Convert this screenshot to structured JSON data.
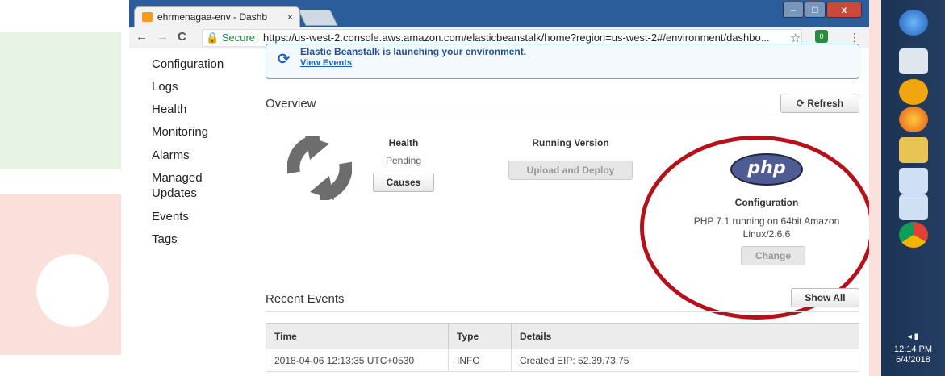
{
  "browser": {
    "tab_title": "ehrmenagaa-env - Dashb",
    "tab_close": "×",
    "secure_label": "Secure",
    "url": "https://us-west-2.console.aws.amazon.com/elasticbeanstalk/home?region=us-west-2#/environment/dashbo...",
    "back": "←",
    "forward": "→",
    "reload": "C",
    "star": "☆",
    "menu": "⋮",
    "window_min": "–",
    "window_max": "□",
    "window_close": "x"
  },
  "sidebar": {
    "items": [
      {
        "label": "Configuration"
      },
      {
        "label": "Logs"
      },
      {
        "label": "Health"
      },
      {
        "label": "Monitoring"
      },
      {
        "label": "Alarms"
      },
      {
        "label": "Managed"
      },
      {
        "label": "Updates"
      },
      {
        "label": "Events"
      },
      {
        "label": "Tags"
      }
    ]
  },
  "banner": {
    "title": "Elastic Beanstalk is launching your environment.",
    "link": "View Events",
    "icon": "refresh-icon"
  },
  "overview": {
    "title": "Overview",
    "refresh_label": "Refresh",
    "health": {
      "heading": "Health",
      "status": "Pending",
      "causes_label": "Causes"
    },
    "running_version": {
      "heading": "Running Version",
      "upload_label": "Upload and Deploy"
    },
    "configuration": {
      "logo_text": "php",
      "heading": "Configuration",
      "description": "PHP 7.1 running on 64bit Amazon Linux/2.6.6",
      "change_label": "Change"
    }
  },
  "recent_events": {
    "title": "Recent Events",
    "show_all_label": "Show All",
    "columns": [
      "Time",
      "Type",
      "Details"
    ],
    "rows": [
      {
        "time": "2018-04-06 12:13:35 UTC+0530",
        "type": "INFO",
        "details": "Created EIP: 52.39.73.75"
      }
    ]
  },
  "taskbar": {
    "time": "12:14 PM",
    "date": "6/4/2018"
  },
  "colors": {
    "accent": "#1560bd",
    "annotation_ring": "#b5111a",
    "info": "#5a8a00",
    "php": "#4f5b93"
  }
}
